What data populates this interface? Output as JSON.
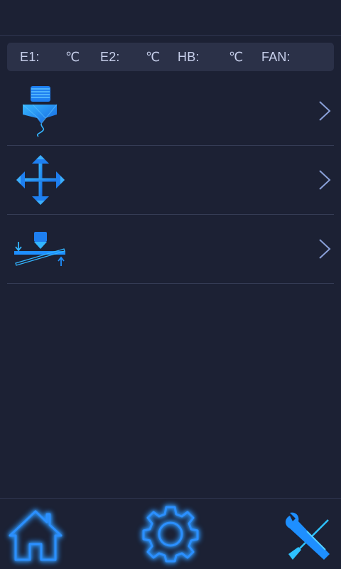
{
  "status": {
    "e1_label": "E1:",
    "e1_unit": "℃",
    "e2_label": "E2:",
    "e2_unit": "℃",
    "hb_label": "HB:",
    "hb_unit": "℃",
    "fan_label": "FAN:"
  },
  "menu": {
    "items": [
      {
        "icon": "extruder-icon",
        "label": ""
      },
      {
        "icon": "move-icon",
        "label": ""
      },
      {
        "icon": "leveling-icon",
        "label": ""
      }
    ]
  },
  "bottom_nav": {
    "items": [
      {
        "icon": "home-icon"
      },
      {
        "icon": "gear-icon"
      },
      {
        "icon": "tools-icon"
      }
    ]
  },
  "colors": {
    "background": "#1c2134",
    "status_bg": "#2b3148",
    "text": "#c8d0ec",
    "accent": "#1e8fff",
    "accent_light": "#33b5ff",
    "divider": "#353c55"
  }
}
